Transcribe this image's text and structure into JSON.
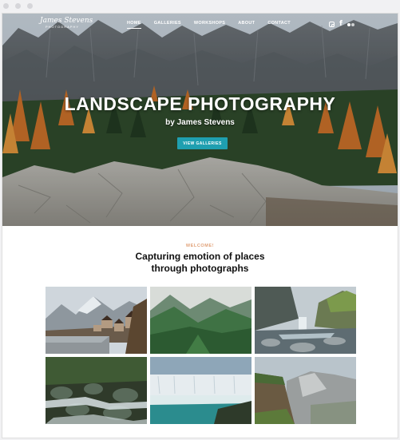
{
  "site": {
    "logo_name": "James Stevens",
    "logo_sub": "PHOTOGRAPHY"
  },
  "nav": {
    "items": [
      {
        "label": "HOME"
      },
      {
        "label": "GALLERIES"
      },
      {
        "label": "WORKSHOPS"
      },
      {
        "label": "ABOUT"
      },
      {
        "label": "CONTACT"
      }
    ],
    "active_index": 0
  },
  "social": {
    "icons": [
      "instagram-icon",
      "facebook-icon",
      "flickr-icon"
    ],
    "facebook_glyph": "f"
  },
  "hero": {
    "title": "LANDSCAPE PHOTOGRAPHY",
    "subtitle": "by James Stevens",
    "cta_label": "VIEW GALLERIES"
  },
  "intro": {
    "eyebrow": "WELCOME!",
    "heading_line1": "Capturing emotion of places",
    "heading_line2": "through photographs"
  },
  "gallery": {
    "tiles": [
      {
        "name": "mountain-village"
      },
      {
        "name": "green-valley"
      },
      {
        "name": "mountain-waterfall"
      },
      {
        "name": "forest-stream"
      },
      {
        "name": "niagara-falls"
      },
      {
        "name": "granite-cliffs"
      }
    ]
  },
  "colors": {
    "accent": "#1f9fb0",
    "eyebrow": "#e1a178",
    "heading": "#111111"
  }
}
